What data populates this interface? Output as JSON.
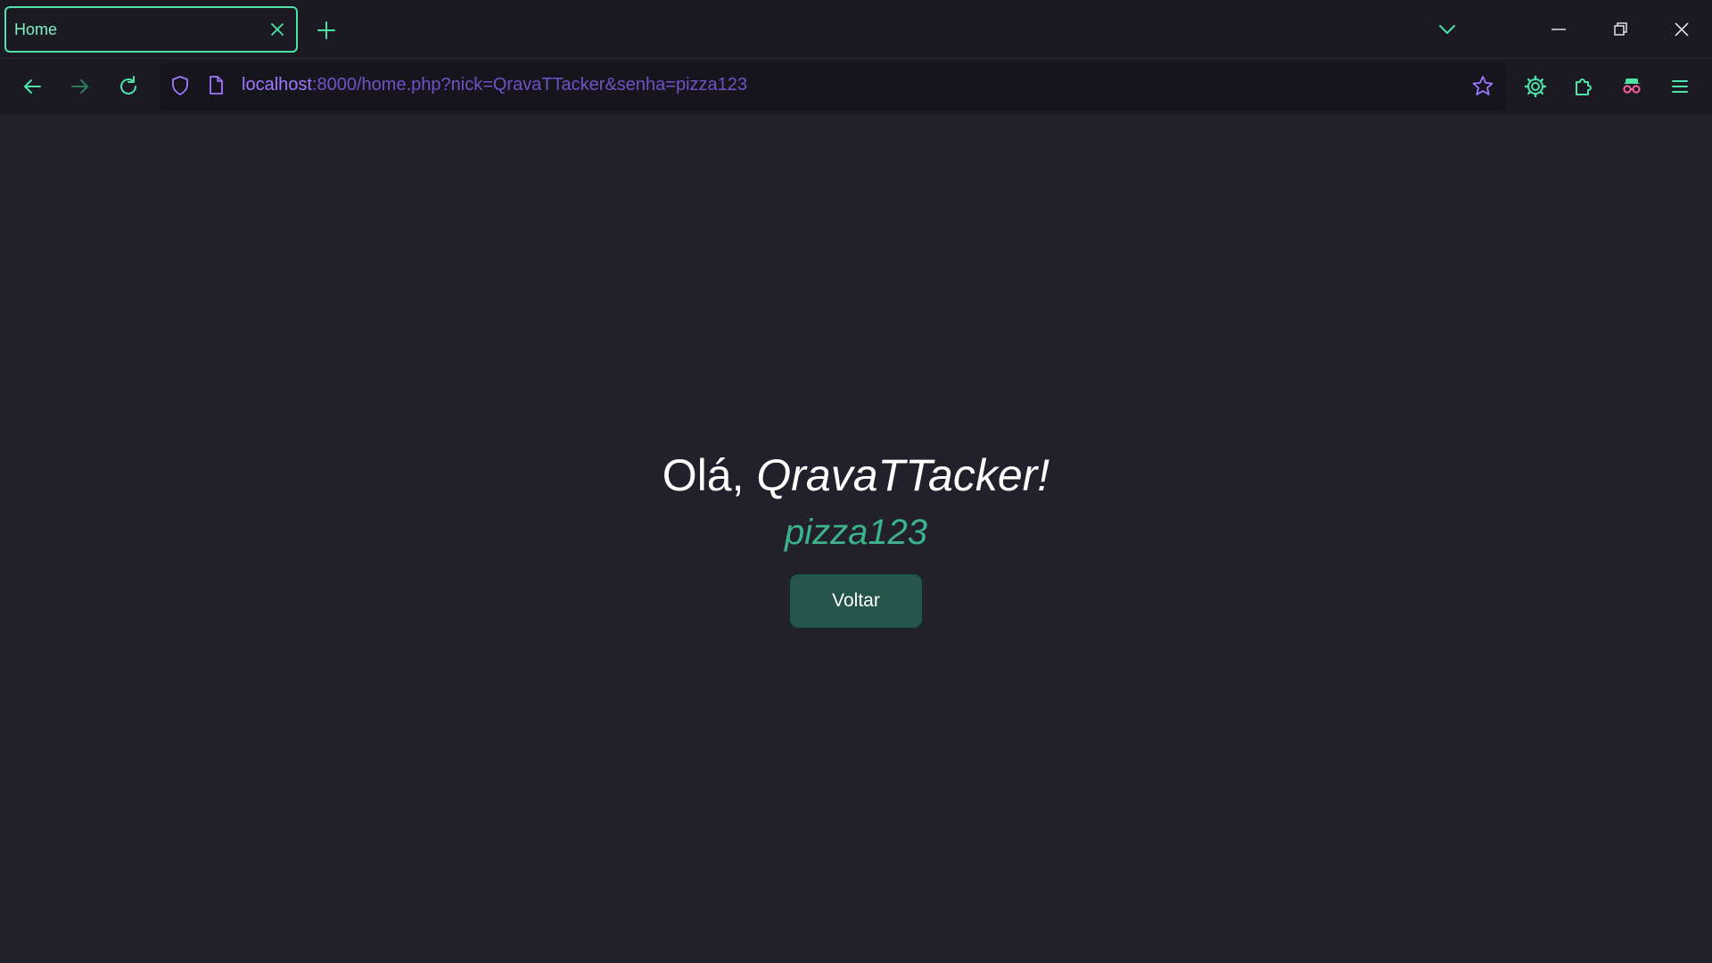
{
  "tab": {
    "title": "Home"
  },
  "urlbar": {
    "host": "localhost",
    "rest": ":8000/home.php?nick=QravaTTacker&senha=pizza123"
  },
  "page": {
    "greeting_prefix": "Olá, ",
    "greeting_name": "QravaTTacker!",
    "password": "pizza123",
    "back_button_label": "Voltar"
  },
  "icons": {
    "tab_close": "close-icon",
    "new_tab": "plus-icon",
    "list_tabs": "chevron-down-icon",
    "minimize": "minimize-icon",
    "restore": "restore-icon",
    "close_window": "close-icon",
    "back": "arrow-left-icon",
    "forward": "arrow-right-icon",
    "reload": "reload-icon",
    "shield": "shield-icon",
    "page": "page-icon",
    "bookmark": "star-icon",
    "settings": "gear-icon",
    "extensions": "puzzle-icon",
    "account": "incognito-icon",
    "menu": "hamburger-icon"
  },
  "colors": {
    "accent": "#4be3a8",
    "url_host": "#a078ff",
    "url_rest": "#6f52c7",
    "background": "#21202b",
    "password_text": "#3bb38a",
    "button_bg": "#24544a"
  }
}
